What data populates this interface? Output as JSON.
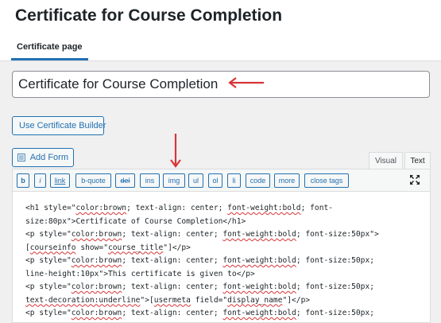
{
  "header": {
    "title": "Certificate for Course Completion",
    "tab_label": "Certificate page"
  },
  "title_field": {
    "value": "Certificate for Course Completion"
  },
  "buttons": {
    "certificate_builder": "Use Certificate Builder",
    "add_form": "Add Form"
  },
  "editor_tabs": {
    "visual": "Visual",
    "text": "Text"
  },
  "quicktags": [
    "b",
    "i",
    "link",
    "b-quote",
    "del",
    "ins",
    "img",
    "ul",
    "ol",
    "li",
    "code",
    "more",
    "close tags"
  ],
  "code_lines": [
    [
      {
        "t": "<h1 style=\""
      },
      {
        "t": "color:brown",
        "s": 1
      },
      {
        "t": "; text-align: center; "
      },
      {
        "t": "font-weight:bold",
        "s": 1
      },
      {
        "t": "; font-"
      }
    ],
    [
      {
        "t": "size:80px\">Certificate of Course Completion</h1>"
      }
    ],
    [
      {
        "t": "<p style=\""
      },
      {
        "t": "color:brown",
        "s": 1
      },
      {
        "t": "; text-align: center; "
      },
      {
        "t": "font-weight:bold",
        "s": 1
      },
      {
        "t": "; font-size:50px\">"
      }
    ],
    [
      {
        "t": "["
      },
      {
        "t": "courseinfo",
        "s": 1
      },
      {
        "t": " show=\""
      },
      {
        "t": "course_title",
        "s": 1
      },
      {
        "t": "\"]</p>"
      }
    ],
    [
      {
        "t": "<p style=\""
      },
      {
        "t": "color:brown",
        "s": 1
      },
      {
        "t": "; text-align: center; "
      },
      {
        "t": "font-weight:bold",
        "s": 1
      },
      {
        "t": "; font-size:50px;"
      }
    ],
    [
      {
        "t": "line-height:10px\">This certificate is given to</p>"
      }
    ],
    [
      {
        "t": "<p style=\""
      },
      {
        "t": "color:brown",
        "s": 1
      },
      {
        "t": "; text-align: center; "
      },
      {
        "t": "font-weight:bold",
        "s": 1
      },
      {
        "t": "; font-size:50px;"
      }
    ],
    [
      {
        "t": "text-decoration:underline",
        "s": 1
      },
      {
        "t": "\">["
      },
      {
        "t": "usermeta",
        "s": 1
      },
      {
        "t": " field=\""
      },
      {
        "t": "display_name",
        "s": 1
      },
      {
        "t": "\"]</p>"
      }
    ],
    [
      {
        "t": "<p style=\""
      },
      {
        "t": "color:brown",
        "s": 1
      },
      {
        "t": "; text-align: center; "
      },
      {
        "t": "font-weight:bold",
        "s": 1
      },
      {
        "t": "; font-size:50px;"
      }
    ]
  ],
  "colors": {
    "accent": "#2271b1",
    "arrow": "#d63638",
    "background": "#f0f0f1"
  },
  "icons": {
    "add_form": "form-icon",
    "fullscreen": "fullscreen-icon",
    "arrow_title": "arrow-left-icon",
    "arrow_img": "arrow-down-icon"
  }
}
